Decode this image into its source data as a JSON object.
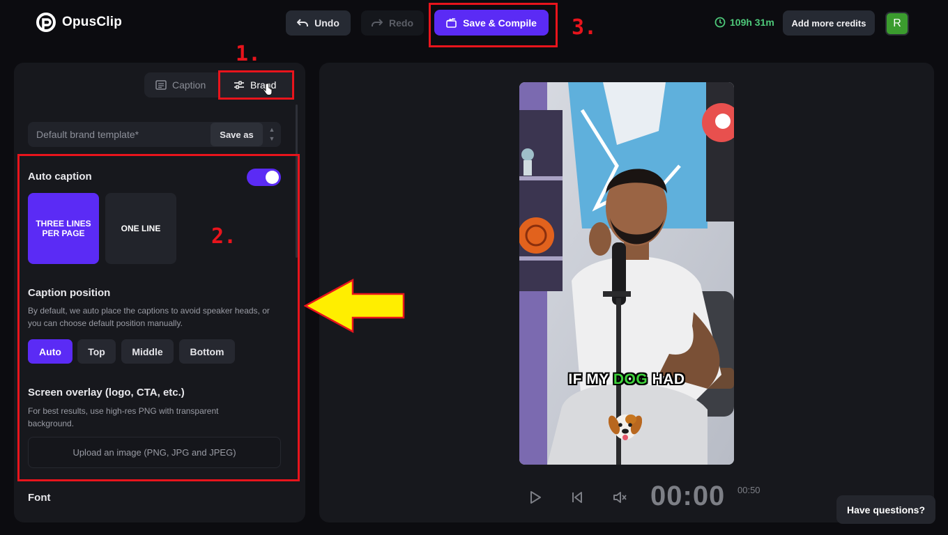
{
  "app": {
    "name": "OpusClip"
  },
  "toolbar": {
    "undo_label": "Undo",
    "redo_label": "Redo",
    "save_label": "Save & Compile",
    "credits_time": "109h 31m",
    "add_credits_label": "Add more credits",
    "avatar_initial": "R"
  },
  "annotations": {
    "one": "1.",
    "two": "2.",
    "three": "3."
  },
  "sidebar": {
    "tabs": [
      {
        "label": "Caption"
      },
      {
        "label": "Brand"
      }
    ],
    "template": {
      "name": "Default brand template*",
      "save_as_label": "Save as"
    },
    "auto_caption": {
      "title": "Auto caption",
      "enabled": true
    },
    "caption_styles": [
      {
        "label": "THREE LINES PER PAGE",
        "selected": true
      },
      {
        "label": "ONE LINE",
        "selected": false
      }
    ],
    "caption_position": {
      "title": "Caption position",
      "description": "By default, we auto place the captions to avoid speaker heads, or you can choose default position manually.",
      "options": [
        {
          "label": "Auto",
          "selected": true
        },
        {
          "label": "Top"
        },
        {
          "label": "Middle"
        },
        {
          "label": "Bottom"
        }
      ]
    },
    "screen_overlay": {
      "title": "Screen overlay (logo, CTA, etc.)",
      "description": "For best results, use high-res PNG with transparent background.",
      "upload_label": "Upload an image (PNG, JPG and JPEG)"
    },
    "font_title": "Font"
  },
  "preview": {
    "caption_words": [
      {
        "text": "IF MY "
      },
      {
        "text": "DOG",
        "highlight": true
      },
      {
        "text": " HAD"
      }
    ],
    "caption_highlight_color": "#3fd33c",
    "timecode": "00:00",
    "duration": "00:50"
  },
  "help_label": "Have questions?",
  "colors": {
    "accent": "#5b2bf5",
    "annotation_red": "#e8141c",
    "arrow_yellow": "#ffee00",
    "credits_green": "#4ec97a"
  }
}
